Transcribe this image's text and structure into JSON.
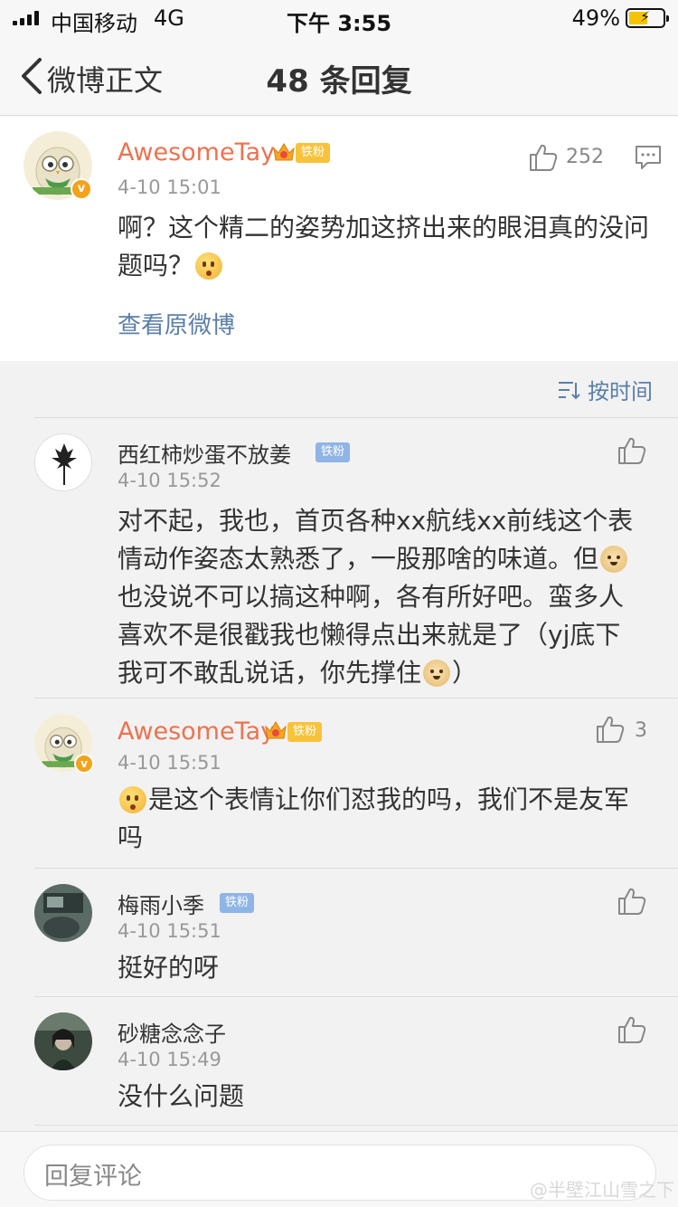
{
  "status_bar": {
    "carrier": "中国移动",
    "network": "4G",
    "time": "下午 3:55",
    "battery": "49%"
  },
  "nav": {
    "back_label": "微博正文",
    "title": "48 条回复"
  },
  "main_comment": {
    "username": "AwesomeTay",
    "fan_badge": "铁粉",
    "timestamp": "4-10 15:01",
    "likes": "252",
    "text": "啊？这个精二的姿势加这挤出来的眼泪真的没问题吗？",
    "view_original": "查看原微博"
  },
  "sort": {
    "label": "按时间"
  },
  "replies": [
    {
      "username": "西红柿炒蛋不放姜",
      "fan_badge": "铁粉",
      "timestamp": "4-10 15:52",
      "text_parts": [
        "对不起，我也，首页各种xx航线xx前线这个表情动作姿态太熟悉了，一股那啥的味道。但",
        "也没说不可以搞这种啊，各有所好吧。蛮多人喜欢不是很戳我也懒得点出来就是了（yj底下我可不敢乱说话，你先撑住",
        "）"
      ],
      "likes": ""
    },
    {
      "username": "AwesomeTay",
      "fan_badge": "铁粉",
      "timestamp": "4-10 15:51",
      "text": "是这个表情让你们怼我的吗，我们不是友军吗",
      "likes": "3"
    },
    {
      "username": "梅雨小季",
      "fan_badge": "铁粉",
      "timestamp": "4-10 15:51",
      "text": "挺好的呀",
      "likes": ""
    },
    {
      "username": "砂糖念念子",
      "timestamp": "4-10 15:49",
      "text": "没什么问题",
      "likes": ""
    }
  ],
  "footer": {
    "input_placeholder": "回复评论",
    "watermark": "@半壁江山雪之下"
  },
  "colors": {
    "username_orange": "#eb7350",
    "link_blue": "#5b7fa8",
    "badge_gold": "#f8c23a",
    "badge_blue": "#8fb4e6",
    "verified": "#f3a21c"
  }
}
